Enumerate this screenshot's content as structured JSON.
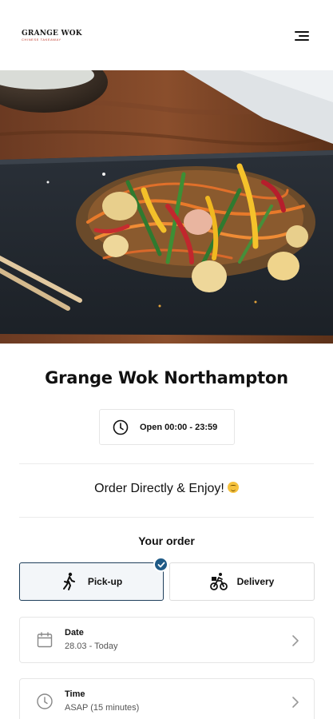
{
  "brand": {
    "logo_main": "GRANGE WOK",
    "logo_sub": "CHINESE TAKEAWAY"
  },
  "header": {
    "menu_icon": "hamburger-menu-icon"
  },
  "restaurant": {
    "name": "Grange Wok Northampton",
    "hours": "Open 00:00 - 23:59"
  },
  "tagline": "Order Directly & Enjoy!",
  "order": {
    "heading": "Your order",
    "options": [
      {
        "label": "Pick-up",
        "icon": "walking-person-icon",
        "selected": true
      },
      {
        "label": "Delivery",
        "icon": "cyclist-icon",
        "selected": false
      }
    ],
    "date": {
      "title": "Date",
      "value": "28.03 - Today",
      "icon": "calendar-icon"
    },
    "time": {
      "title": "Time",
      "value": "ASAP (15 minutes)",
      "icon": "clock-icon"
    }
  },
  "colors": {
    "accent": "#1f5a86",
    "border_selected": "#1f3f5b",
    "text": "#111111"
  }
}
